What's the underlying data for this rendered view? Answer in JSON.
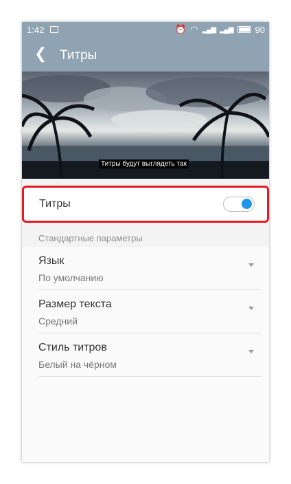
{
  "status_bar": {
    "time": "1:42",
    "battery": "90"
  },
  "header": {
    "title": "Титры"
  },
  "preview": {
    "caption": "Титры будут выглядеть так"
  },
  "captions_toggle": {
    "label": "Титры",
    "enabled": true
  },
  "section": {
    "title": "Стандартные параметры"
  },
  "settings": [
    {
      "name": "Язык",
      "value": "По умолчанию"
    },
    {
      "name": "Размер текста",
      "value": "Средний"
    },
    {
      "name": "Стиль титров",
      "value": "Белый на чёрном"
    }
  ],
  "colors": {
    "accent": "#2196e6",
    "highlight": "#e01b24",
    "appbar": "#8fa3b2"
  }
}
